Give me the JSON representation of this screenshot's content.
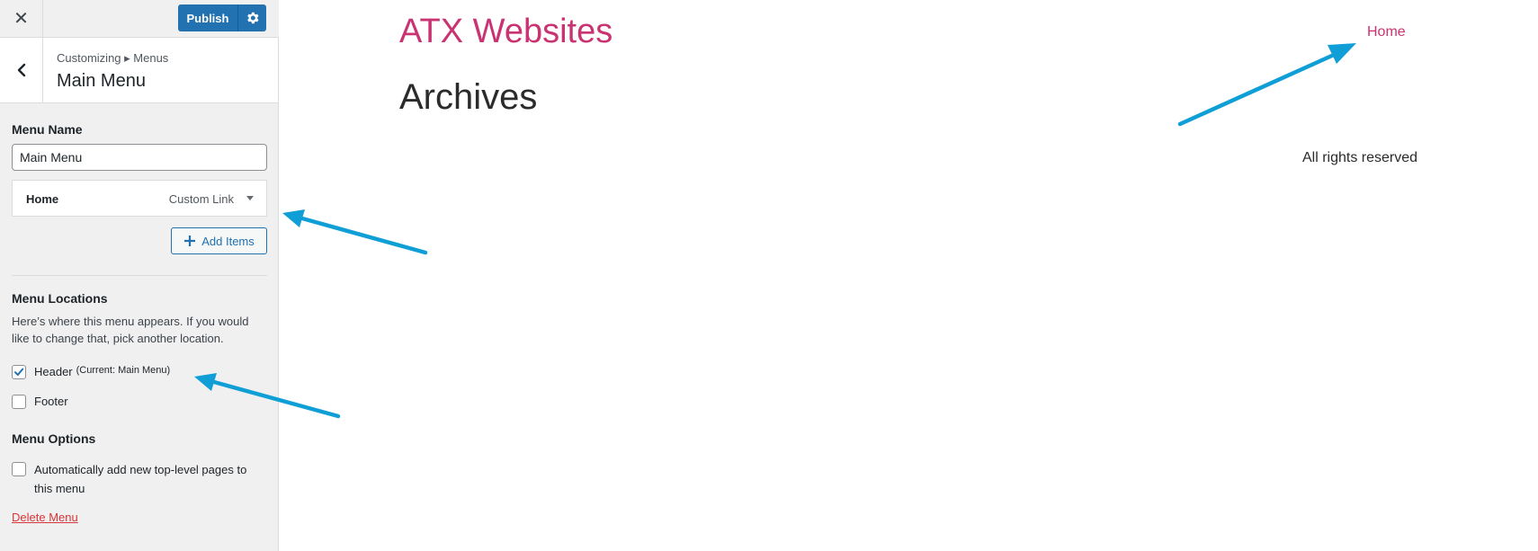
{
  "sidebar": {
    "close_icon_glyph": "✕",
    "publish_label": "Publish",
    "breadcrumb": "Customizing ▸ Menus",
    "section_title": "Main Menu",
    "menu_name_label": "Menu Name",
    "menu_name_value": "Main Menu",
    "menu_item": {
      "title": "Home",
      "type": "Custom Link"
    },
    "add_items_label": "Add Items",
    "locations_heading": "Menu Locations",
    "locations_description": "Here’s where this menu appears. If you would like to change that, pick another location.",
    "locations": [
      {
        "label": "Header",
        "note": "(Current: Main Menu)",
        "checked": true
      },
      {
        "label": "Footer",
        "note": "",
        "checked": false
      }
    ],
    "options_heading": "Menu Options",
    "auto_add_label": "Automatically add new top-level pages to this menu",
    "auto_add_checked": false,
    "delete_label": "Delete Menu"
  },
  "preview": {
    "site_title": "ATX Websites",
    "nav_home": "Home",
    "page_title": "Archives",
    "footer_text": "All rights reserved"
  },
  "colors": {
    "accent_blue": "#2271b1",
    "site_pink": "#c93371",
    "annotation_arrow": "#0f9fd6",
    "delete_red": "#d63638"
  }
}
